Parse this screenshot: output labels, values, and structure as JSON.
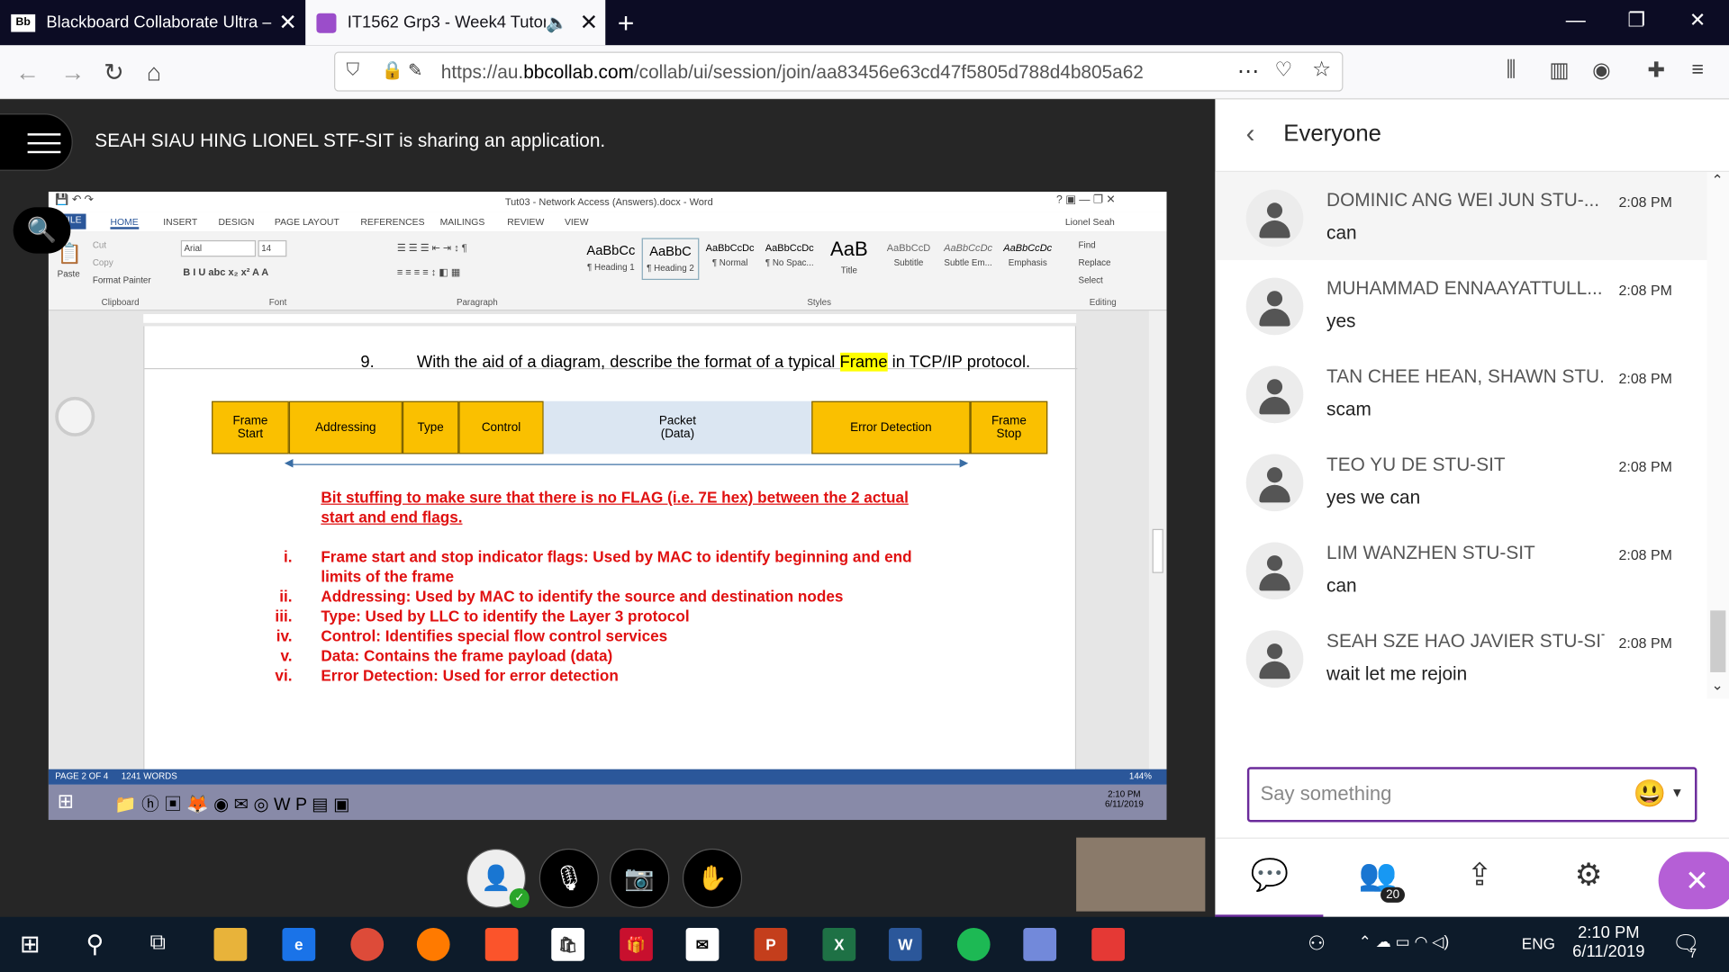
{
  "browser": {
    "tabs": [
      {
        "title": "Blackboard Collaborate Ultra –",
        "favicon": "Bb",
        "active": false
      },
      {
        "title": "IT1562 Grp3 - Week4 Tutori",
        "favicon": "collab-icon",
        "active": true
      }
    ],
    "url_prefix": "https://au.",
    "url_domain": "bbcollab.com",
    "url_path": "/collab/ui/session/join/aa83456e63cd47f5805d788d4b805a62"
  },
  "session": {
    "sharing_text": "SEAH SIAU HING LIONEL STF-SIT is sharing an application."
  },
  "word": {
    "title": "Tut03 - Network Access (Answers).docx - Word",
    "user": "Lionel Seah",
    "ribbon_tabs": [
      "FILE",
      "HOME",
      "INSERT",
      "DESIGN",
      "PAGE LAYOUT",
      "REFERENCES",
      "MAILINGS",
      "REVIEW",
      "VIEW"
    ],
    "font_name": "Arial",
    "font_size": "14",
    "clipboard": {
      "paste": "Paste",
      "cut": "Cut",
      "copy": "Copy",
      "format_painter": "Format Painter"
    },
    "group_labels": [
      "Clipboard",
      "Font",
      "Paragraph",
      "Styles",
      "Editing"
    ],
    "styles": [
      {
        "sample": "AaBbCc",
        "label": "¶ Heading 1"
      },
      {
        "sample": "AaBbC",
        "label": "¶ Heading 2"
      },
      {
        "sample": "AaBbCcDc",
        "label": "¶ Normal"
      },
      {
        "sample": "AaBbCcDc",
        "label": "¶ No Spac..."
      },
      {
        "sample": "AaB",
        "label": "Title"
      },
      {
        "sample": "AaBbCcD",
        "label": "Subtitle"
      },
      {
        "sample": "AaBbCcDc",
        "label": "Subtle Em..."
      },
      {
        "sample": "AaBbCcDc",
        "label": "Emphasis"
      }
    ],
    "editing": {
      "find": "Find",
      "replace": "Replace",
      "select": "Select"
    },
    "question_number": "9.",
    "question_before": "With the aid of a diagram, describe the format of a typical ",
    "question_highlight": "Frame",
    "question_after": " in TCP/IP protocol.",
    "frame_fields": [
      {
        "line1": "Frame",
        "line2": "Start",
        "color": "#fac000"
      },
      {
        "line1": "Addressing",
        "line2": "",
        "color": "#fac000"
      },
      {
        "line1": "Type",
        "line2": "",
        "color": "#fac000"
      },
      {
        "line1": "Control",
        "line2": "",
        "color": "#fac000"
      },
      {
        "line1": "Packet",
        "line2": "(Data)",
        "color": "#dbe6f2"
      },
      {
        "line1": "Error Detection",
        "line2": "",
        "color": "#fac000"
      },
      {
        "line1": "Frame",
        "line2": "Stop",
        "color": "#fac000"
      }
    ],
    "bit_stuffing_line1": "Bit stuffing to make sure that there is no FLAG (i.e. 7E hex) between the 2 actual",
    "bit_stuffing_line2": "start and end flags.",
    "answers": [
      {
        "num": "i.",
        "text": "Frame start and stop indicator flags: Used by MAC to identify beginning and end",
        "text2": "limits of the frame"
      },
      {
        "num": "ii.",
        "text": "Addressing: Used by MAC to identify the source and destination nodes"
      },
      {
        "num": "iii.",
        "text": "Type: Used by LLC to identify the Layer 3 protocol"
      },
      {
        "num": "iv.",
        "text": "Control: Identifies special flow control services"
      },
      {
        "num": "v.",
        "text": "Data: Contains the frame payload (data)"
      },
      {
        "num": "vi.",
        "text": "Error Detection: Used for error detection"
      }
    ],
    "status_page": "PAGE 2 OF 4",
    "status_words": "1241 WORDS",
    "zoom": "144%",
    "inner_clock_time": "2:10 PM",
    "inner_clock_date": "6/11/2019"
  },
  "chat": {
    "header": "Everyone",
    "messages": [
      {
        "name": "DOMINIC ANG WEI JUN STU-...",
        "time": "2:08 PM",
        "text": "can"
      },
      {
        "name": "MUHAMMAD ENNAAYATTULL...",
        "time": "2:08 PM",
        "text": "yes"
      },
      {
        "name": "TAN CHEE HEAN, SHAWN STU...",
        "time": "2:08 PM",
        "text": "scam"
      },
      {
        "name": "TEO YU DE STU-SIT",
        "time": "2:08 PM",
        "text": "yes we can"
      },
      {
        "name": "LIM WANZHEN STU-SIT",
        "time": "2:08 PM",
        "text": "can"
      },
      {
        "name": "SEAH SZE HAO JAVIER STU-SIT",
        "time": "2:08 PM",
        "text": "wait let me rejoin"
      }
    ],
    "placeholder": "Say something",
    "attendee_count": "20"
  },
  "taskbar": {
    "language": "ENG",
    "time": "2:10 PM",
    "date": "6/11/2019",
    "notifications": "7"
  }
}
